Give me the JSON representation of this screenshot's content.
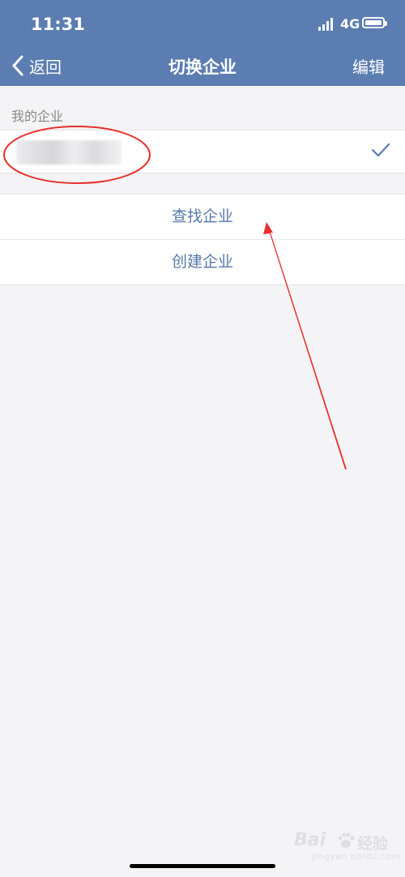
{
  "status_bar": {
    "time": "11:31",
    "network": "4G"
  },
  "nav": {
    "back_label": "返回",
    "title": "切换企业",
    "edit_label": "编辑"
  },
  "section": {
    "my_companies_header": "我的企业"
  },
  "companies": [
    {
      "name": "",
      "selected": true
    }
  ],
  "actions": {
    "find_company": "查找企业",
    "create_company": "创建企业"
  },
  "watermark": {
    "text1": "Bai",
    "text2": "经验",
    "sub": "jingyan.baidu.com"
  },
  "colors": {
    "nav_bg": "#5b7db1",
    "action_text": "#5878a8",
    "annotation_red": "#e8302a",
    "page_bg": "#f4f4f6"
  }
}
